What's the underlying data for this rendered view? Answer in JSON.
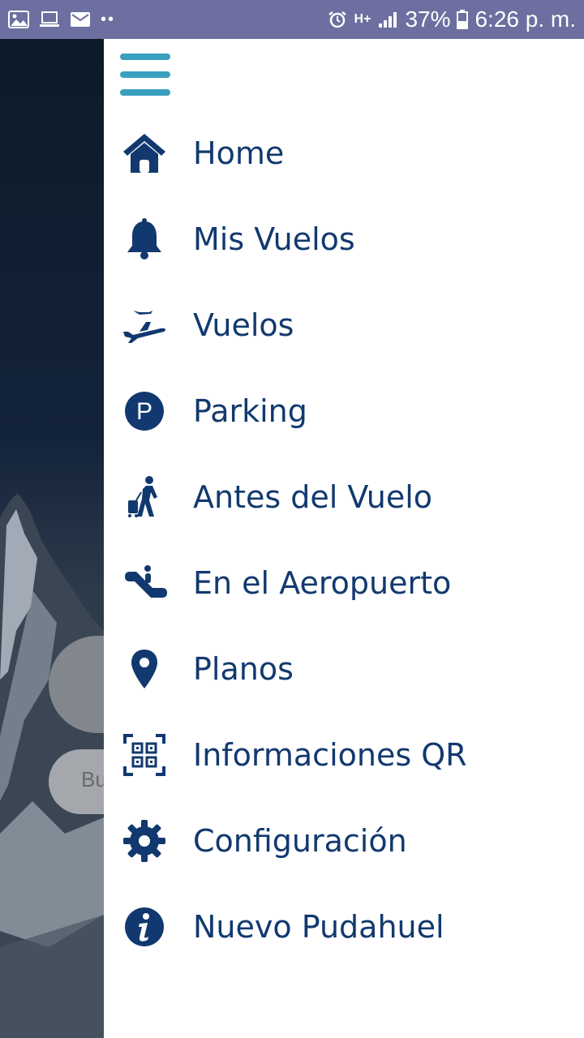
{
  "status_bar": {
    "battery": "37%",
    "time": "6:26 p. m.",
    "network": "H+",
    "icons": [
      "image-icon",
      "laptop-icon",
      "mail-icon",
      "more-dots-icon",
      "alarm-icon",
      "network-icon",
      "signal-icon",
      "battery-icon"
    ]
  },
  "background": {
    "search_placeholder": "Bu"
  },
  "drawer": {
    "menu_button_icon": "hamburger-icon",
    "accent_color": "#3a9fbf",
    "text_color": "#12396f",
    "items": [
      {
        "label": "Home",
        "icon": "home-icon"
      },
      {
        "label": "Mis Vuelos",
        "icon": "bell-icon"
      },
      {
        "label": "Vuelos",
        "icon": "airplane-icon"
      },
      {
        "label": "Parking",
        "icon": "parking-icon"
      },
      {
        "label": "Antes del Vuelo",
        "icon": "traveler-icon"
      },
      {
        "label": "En el Aeropuerto",
        "icon": "escalator-icon"
      },
      {
        "label": "Planos",
        "icon": "map-pin-icon"
      },
      {
        "label": "Informaciones QR",
        "icon": "qr-code-icon"
      },
      {
        "label": "Configuración",
        "icon": "gear-icon"
      },
      {
        "label": "Nuevo Pudahuel",
        "icon": "info-icon"
      }
    ]
  }
}
